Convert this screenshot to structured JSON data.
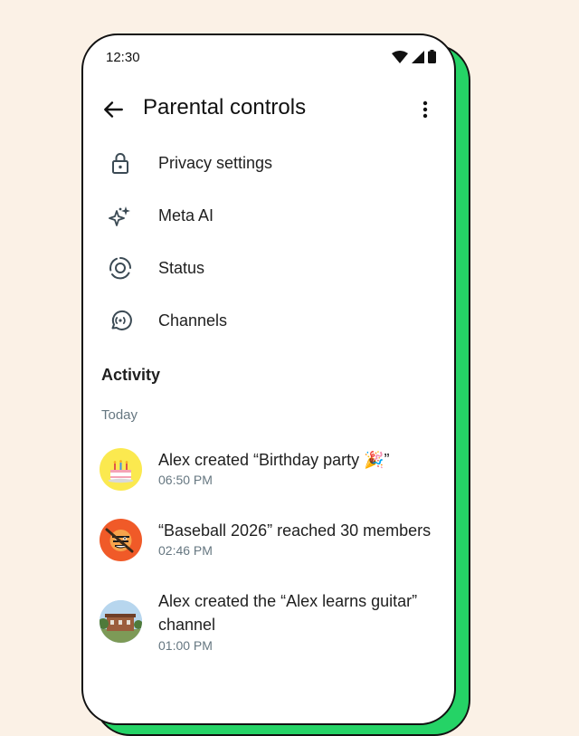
{
  "statusbar": {
    "time": "12:30"
  },
  "appbar": {
    "title": "Parental controls"
  },
  "menu": [
    {
      "label": "Privacy settings",
      "icon": "lock-icon"
    },
    {
      "label": "Meta AI",
      "icon": "sparkle-icon"
    },
    {
      "label": "Status",
      "icon": "status-ring-icon"
    },
    {
      "label": "Channels",
      "icon": "channels-icon"
    }
  ],
  "activity": {
    "title": "Activity",
    "group_label": "Today",
    "items": [
      {
        "text": "Alex created “Birthday party 🎉”",
        "time": "06:50 PM",
        "avatar": "birthday-cake-avatar"
      },
      {
        "text": "“Baseball 2026” reached 30 members",
        "time": "02:46 PM",
        "avatar": "baseball-tiger-avatar"
      },
      {
        "text": "Alex created the “Alex learns guitar” channel",
        "time": "01:00 PM",
        "avatar": "building-avatar"
      }
    ]
  },
  "colors": {
    "accent": "#25d366",
    "background": "#fbf1e6",
    "secondary_text": "#667781"
  }
}
